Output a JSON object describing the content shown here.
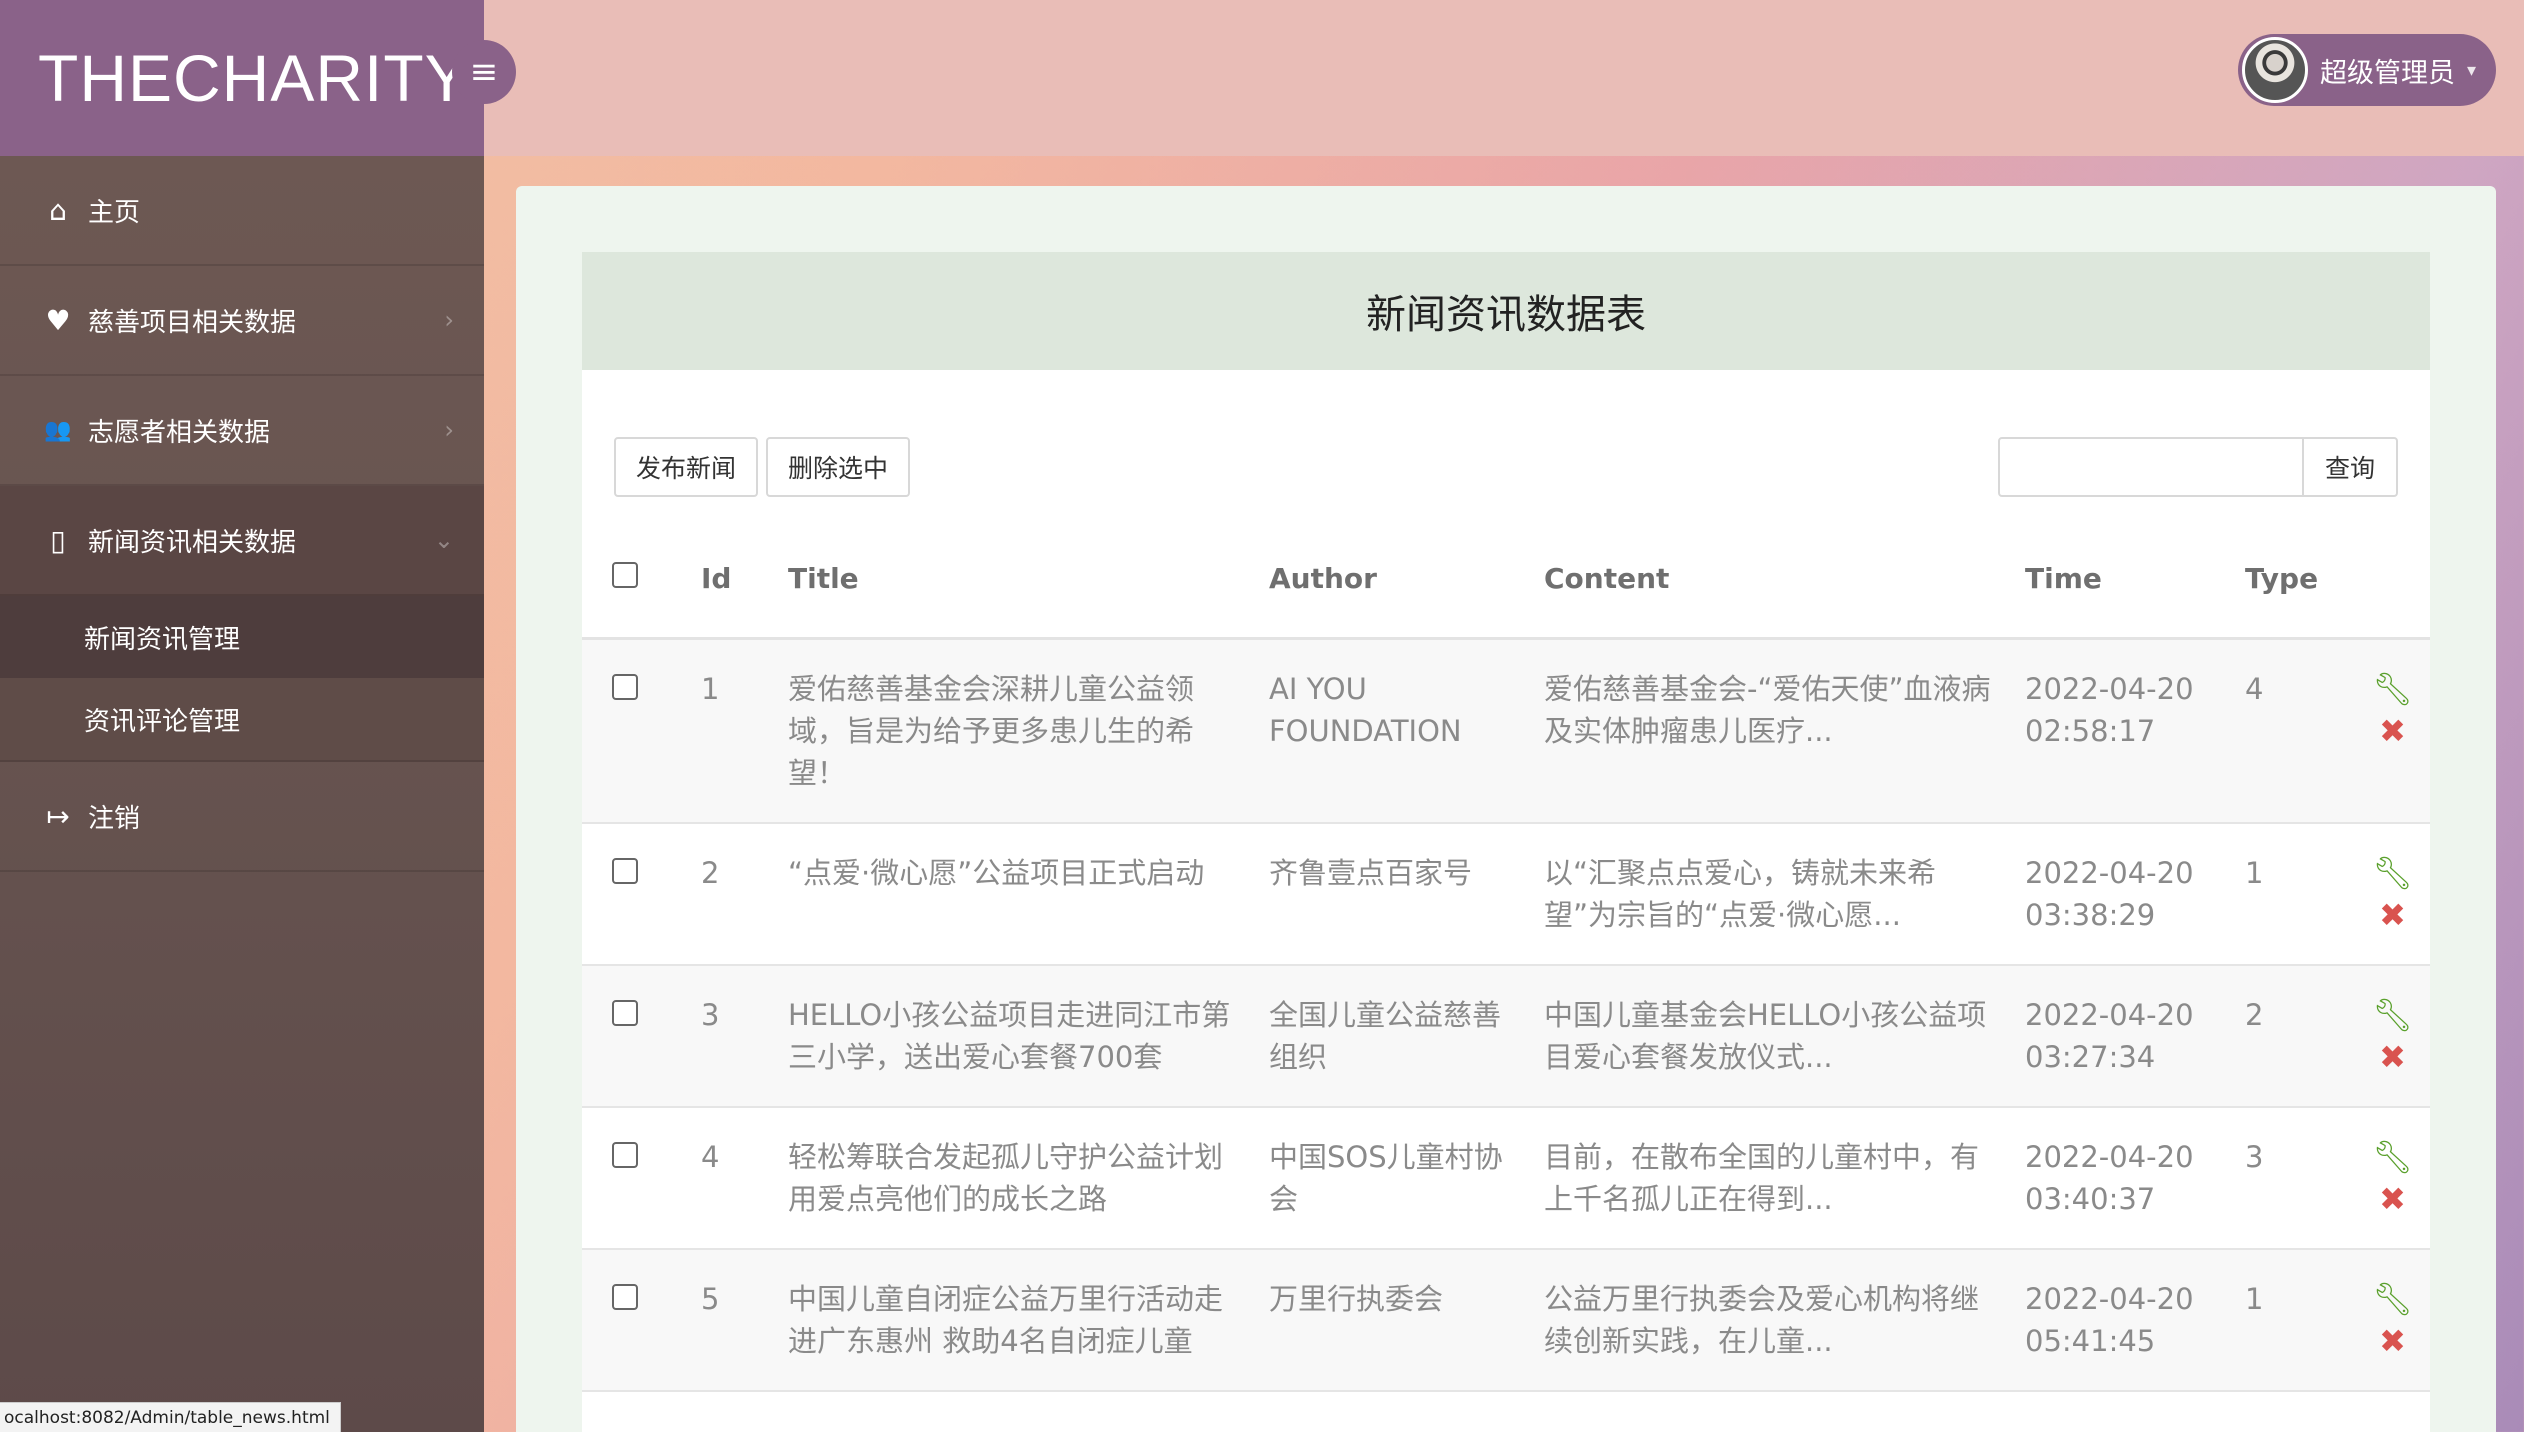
{
  "brand": {
    "title": "THECHARITY"
  },
  "header": {
    "menu_icon": "≡",
    "user": {
      "name": "超级管理员",
      "caret": "▾"
    }
  },
  "sidebar": {
    "items": [
      {
        "label": "主页",
        "icon": "⌂"
      },
      {
        "label": "慈善项目相关数据",
        "icon": "♥",
        "chevron": "›"
      },
      {
        "label": "志愿者相关数据",
        "icon": "👥",
        "chevron": "›"
      },
      {
        "label": "新闻资讯相关数据",
        "icon": "▯",
        "chevron": "⌄"
      },
      {
        "label": "注销",
        "icon": "↦"
      }
    ],
    "subitems": [
      {
        "label": "新闻资讯管理"
      },
      {
        "label": "资讯评论管理"
      }
    ]
  },
  "panel": {
    "title": "新闻资讯数据表",
    "buttons": {
      "publish": "发布新闻",
      "delete": "删除选中",
      "search": "查询"
    },
    "search": {
      "value": "",
      "placeholder": ""
    }
  },
  "table": {
    "headers": {
      "id": "Id",
      "title": "Title",
      "author": "Author",
      "content": "Content",
      "time": "Time",
      "type": "Type"
    },
    "rows": [
      {
        "id": "1",
        "title": "爱佑慈善基金会深耕儿童公益领域，旨是为给予更多患儿生的希望！",
        "author": "AI YOU FOUNDATION",
        "content": "爱佑慈善基金会-“爱佑天使”血液病及实体肿瘤患儿医疗...",
        "date": "2022-04-20",
        "clock": "02:58:17",
        "type": "4"
      },
      {
        "id": "2",
        "title": "“点爱·微心愿”公益项目正式启动",
        "author": "齐鲁壹点百家号",
        "content": "以“汇聚点点爱心，铸就未来希望”为宗旨的“点爱·微心愿...",
        "date": "2022-04-20",
        "clock": "03:38:29",
        "type": "1"
      },
      {
        "id": "3",
        "title": "HELLO小孩公益项目走进同江市第三小学，送出爱心套餐700套",
        "author": "全国儿童公益慈善组织",
        "content": "中国儿童基金会HELLO小孩公益项目爱心套餐发放仪式...",
        "date": "2022-04-20",
        "clock": "03:27:34",
        "type": "2"
      },
      {
        "id": "4",
        "title": "轻松筹联合发起孤儿守护公益计划 用爱点亮他们的成长之路",
        "author": "中国SOS儿童村协会",
        "content": "目前，在散布全国的儿童村中，有上千名孤儿正在得到...",
        "date": "2022-04-20",
        "clock": "03:40:37",
        "type": "3"
      },
      {
        "id": "5",
        "title": "中国儿童自闭症公益万里行活动走进广东惠州 救助4名自闭症儿童",
        "author": "万里行执委会",
        "content": "公益万里行执委会及爱心机构将继续创新实践，在儿童...",
        "date": "2022-04-20",
        "clock": "05:41:45",
        "type": "1"
      }
    ]
  },
  "status_bar": {
    "url": "ocalhost:8082/Admin/table_news.html"
  },
  "colors": {
    "brand": "#8a6289",
    "header": "#e9bdb7",
    "sidebar": "#675450",
    "edit": "#5aa02c",
    "delete": "#d9534f"
  }
}
